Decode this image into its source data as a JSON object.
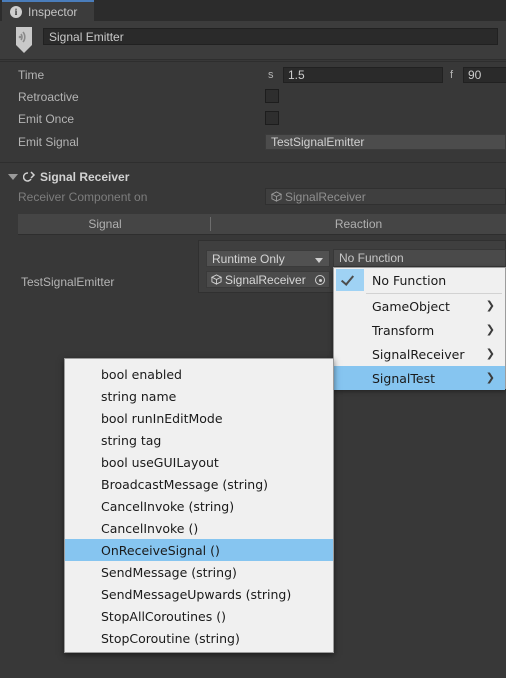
{
  "window": {
    "tab_label": "Inspector",
    "tab_icon": "info-icon",
    "object_name": "Signal Emitter",
    "object_icon": "signal-emitter-marker-icon"
  },
  "properties": {
    "rows": [
      {
        "label": "Time",
        "unit_s": "s",
        "value_s": "1.5",
        "unit_f": "f",
        "value_f": "90"
      },
      {
        "label": "Retroactive",
        "checked": false
      },
      {
        "label": "Emit Once",
        "checked": false
      },
      {
        "label": "Emit Signal",
        "value": "TestSignalEmitter"
      }
    ]
  },
  "signal_receiver": {
    "title": "Signal Receiver",
    "foldout_expanded": true,
    "receiver_component_label": "Receiver Component on",
    "receiver_component_value": "SignalReceiver",
    "columns": {
      "signal": "Signal",
      "reaction": "Reaction"
    },
    "row": {
      "signal_name": "TestSignalEmitter",
      "runtime_mode": "Runtime Only",
      "target_object": "SignalReceiver",
      "function": "No Function"
    }
  },
  "function_menu": {
    "items": [
      {
        "label": "No Function",
        "checked": true,
        "submenu": false,
        "selected": false
      },
      {
        "label": "GameObject",
        "checked": false,
        "submenu": true,
        "selected": false
      },
      {
        "label": "Transform",
        "checked": false,
        "submenu": true,
        "selected": false
      },
      {
        "label": "SignalReceiver",
        "checked": false,
        "submenu": true,
        "selected": false
      },
      {
        "label": "SignalTest",
        "checked": false,
        "submenu": true,
        "selected": true
      }
    ],
    "submenu_arrow_glyph": "❯"
  },
  "method_submenu": {
    "items": [
      {
        "label": "bool enabled",
        "selected": false
      },
      {
        "label": "string name",
        "selected": false
      },
      {
        "label": "bool runInEditMode",
        "selected": false
      },
      {
        "label": "string tag",
        "selected": false
      },
      {
        "label": "bool useGUILayout",
        "selected": false
      },
      {
        "label": "BroadcastMessage (string)",
        "selected": false
      },
      {
        "label": "CancelInvoke (string)",
        "selected": false
      },
      {
        "label": "CancelInvoke ()",
        "selected": false
      },
      {
        "label": "OnReceiveSignal ()",
        "selected": true
      },
      {
        "label": "SendMessage (string)",
        "selected": false
      },
      {
        "label": "SendMessageUpwards (string)",
        "selected": false
      },
      {
        "label": "StopAllCoroutines ()",
        "selected": false
      },
      {
        "label": "StopCoroutine (string)",
        "selected": false
      }
    ]
  },
  "colors": {
    "panel_bg": "#383838",
    "tab_accent": "#4a7dbb",
    "menu_bg": "#f0f0f0",
    "menu_highlight": "#86c5f0",
    "field_bg": "#2a2a2a"
  }
}
